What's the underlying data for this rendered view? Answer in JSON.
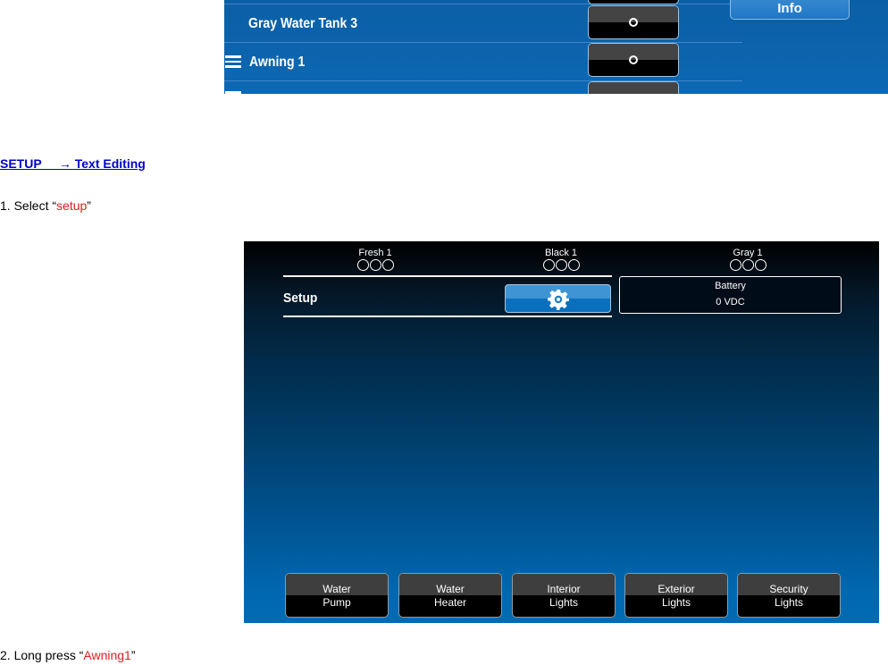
{
  "top_screenshot": {
    "rows": [
      {
        "label": "Gray Water Tank 3",
        "has_menu_icon": false,
        "toggle_state": "off"
      },
      {
        "label": "Awning 1",
        "has_menu_icon": true,
        "toggle_state": "off"
      }
    ],
    "info_button": {
      "label": "Info"
    }
  },
  "document": {
    "heading": "SETUP     → Text Editing",
    "step1": {
      "prefix": "1. Select “",
      "highlight": "setup",
      "suffix": "”"
    },
    "step2": {
      "prefix": "2. Long press “",
      "highlight": "Awning1",
      "suffix": "”"
    }
  },
  "main_screenshot": {
    "tanks": [
      {
        "name": "Fresh 1",
        "level_circles": 3
      },
      {
        "name": "Black 1",
        "level_circles": 3
      },
      {
        "name": "Gray 1",
        "level_circles": 3
      }
    ],
    "setup_label": "Setup",
    "setup_button_icon": "gear-icon",
    "battery": {
      "label": "Battery",
      "value": "0 VDC"
    },
    "function_buttons": [
      {
        "line1": "Water",
        "line2": "Pump"
      },
      {
        "line1": "Water",
        "line2": "Heater"
      },
      {
        "line1": "Interior",
        "line2": "Lights"
      },
      {
        "line1": "Exterior",
        "line2": "Lights"
      },
      {
        "line1": "Security",
        "line2": "Lights"
      }
    ]
  },
  "colors": {
    "link_blue": "#0000cc",
    "highlight_red": "#e31b1b",
    "panel_blue": "#0c68b3"
  }
}
